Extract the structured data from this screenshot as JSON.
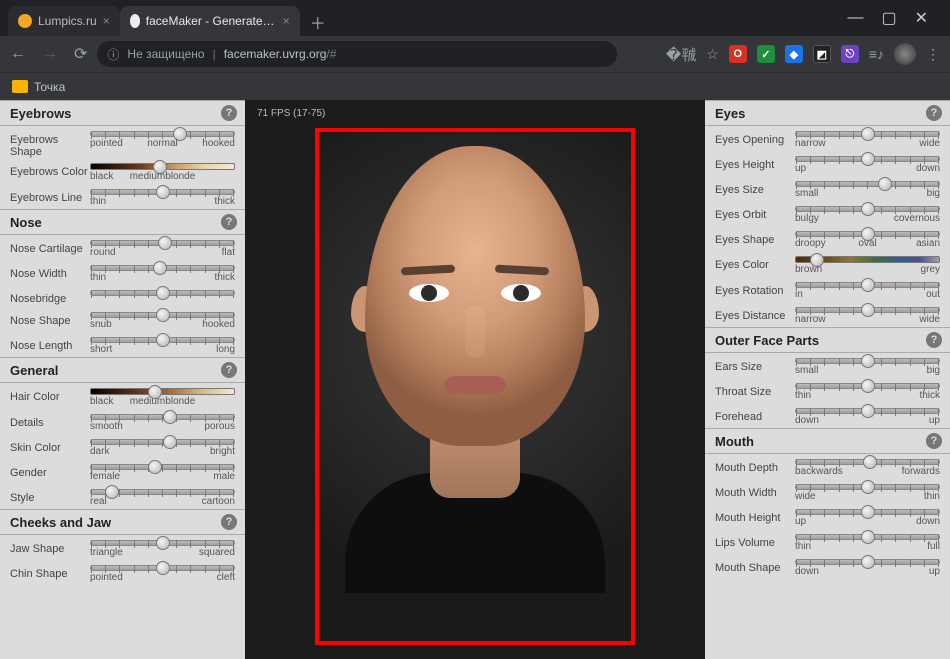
{
  "browser": {
    "tab_inactive": "Lumpics.ru",
    "tab_active": "faceMaker - Generate your favo…",
    "insecure": "Не защищено",
    "url_host": "facemaker.uvrg.org",
    "url_rest": "/#",
    "bookmark": "Точка"
  },
  "viewport": {
    "fps": "71 FPS (17-75)"
  },
  "left": [
    {
      "title": "Eyebrows",
      "rows": [
        {
          "label": "Eyebrows Shape",
          "left": "pointed",
          "mid": "normal",
          "right": "hooked",
          "pos": 62,
          "type": "slider"
        },
        {
          "label": "Eyebrows Color",
          "left": "black",
          "mid": "mediumblonde",
          "right": "",
          "pos": 48,
          "type": "gradient",
          "grad": "linear-gradient(90deg,#000 0%,#6b3b1f 35%,#caa26a 60%,#e8d6b0 80%,#f2e9d8 100%)"
        },
        {
          "label": "Eyebrows Line",
          "left": "thin",
          "right": "thick",
          "pos": 50,
          "type": "slider"
        }
      ]
    },
    {
      "title": "Nose",
      "rows": [
        {
          "label": "Nose Cartilage",
          "left": "round",
          "right": "flat",
          "pos": 52,
          "type": "slider"
        },
        {
          "label": "Nose Width",
          "left": "thin",
          "right": "thick",
          "pos": 48,
          "type": "slider"
        },
        {
          "label": "Nosebridge",
          "pos": 50,
          "type": "slider"
        },
        {
          "label": "Nose Shape",
          "left": "snub",
          "right": "hooked",
          "pos": 50,
          "type": "slider"
        },
        {
          "label": "Nose Length",
          "left": "short",
          "right": "long",
          "pos": 50,
          "type": "slider"
        }
      ]
    },
    {
      "title": "General",
      "rows": [
        {
          "label": "Hair Color",
          "left": "black",
          "mid": "mediumblonde",
          "right": "",
          "pos": 45,
          "type": "gradient",
          "grad": "linear-gradient(90deg,#000 0%,#5c2f16 30%,#a36a3a 55%,#d8bc86 78%,#f2e9d8 100%)"
        },
        {
          "label": "Details",
          "left": "smooth",
          "right": "porous",
          "pos": 55,
          "type": "slider"
        },
        {
          "label": "Skin Color",
          "left": "dark",
          "right": "bright",
          "pos": 55,
          "type": "slider"
        },
        {
          "label": "Gender",
          "left": "female",
          "right": "male",
          "pos": 45,
          "type": "slider"
        },
        {
          "label": "Style",
          "left": "real",
          "right": "cartoon",
          "pos": 15,
          "type": "slider"
        }
      ]
    },
    {
      "title": "Cheeks and Jaw",
      "rows": [
        {
          "label": "Jaw Shape",
          "left": "triangle",
          "right": "squared",
          "pos": 50,
          "type": "slider"
        },
        {
          "label": "Chin Shape",
          "left": "pointed",
          "right": "cleft",
          "pos": 50,
          "type": "slider"
        }
      ]
    }
  ],
  "right": [
    {
      "title": "Eyes",
      "rows": [
        {
          "label": "Eyes Opening",
          "left": "narrow",
          "right": "wide",
          "pos": 50,
          "type": "slider"
        },
        {
          "label": "Eyes Height",
          "left": "up",
          "right": "down",
          "pos": 50,
          "type": "slider"
        },
        {
          "label": "Eyes Size",
          "left": "small",
          "right": "big",
          "pos": 62,
          "type": "slider"
        },
        {
          "label": "Eyes Orbit",
          "left": "bulgy",
          "right": "covernous",
          "pos": 50,
          "type": "slider"
        },
        {
          "label": "Eyes Shape",
          "left": "droopy",
          "mid": "oval",
          "right": "asian",
          "pos": 50,
          "type": "slider"
        },
        {
          "label": "Eyes Color",
          "left": "brown",
          "right": "grey",
          "pos": 15,
          "type": "gradient",
          "grad": "linear-gradient(90deg,#4a2b0e 0%,#7a4418 20%,#8a7a2a 38%,#3f6f3a 55%,#2f5f8f 72%,#4a4aa0 86%,#9aa0a6 100%)"
        },
        {
          "label": "Eyes Rotation",
          "left": "in",
          "right": "out",
          "pos": 50,
          "type": "slider"
        },
        {
          "label": "Eyes Distance",
          "left": "narrow",
          "right": "wide",
          "pos": 50,
          "type": "slider"
        }
      ]
    },
    {
      "title": "Outer Face Parts",
      "rows": [
        {
          "label": "Ears Size",
          "left": "small",
          "right": "big",
          "pos": 50,
          "type": "slider"
        },
        {
          "label": "Throat Size",
          "left": "thin",
          "right": "thick",
          "pos": 50,
          "type": "slider"
        },
        {
          "label": "Forehead",
          "left": "down",
          "right": "up",
          "pos": 50,
          "type": "slider"
        }
      ]
    },
    {
      "title": "Mouth",
      "rows": [
        {
          "label": "Mouth Depth",
          "left": "backwards",
          "right": "forwards",
          "pos": 52,
          "type": "slider"
        },
        {
          "label": "Mouth Width",
          "left": "wide",
          "right": "thin",
          "pos": 50,
          "type": "slider"
        },
        {
          "label": "Mouth Height",
          "left": "up",
          "right": "down",
          "pos": 50,
          "type": "slider"
        },
        {
          "label": "Lips Volume",
          "left": "thin",
          "right": "full",
          "pos": 50,
          "type": "slider"
        },
        {
          "label": "Mouth Shape",
          "left": "down",
          "right": "up",
          "pos": 50,
          "type": "slider"
        }
      ]
    }
  ]
}
